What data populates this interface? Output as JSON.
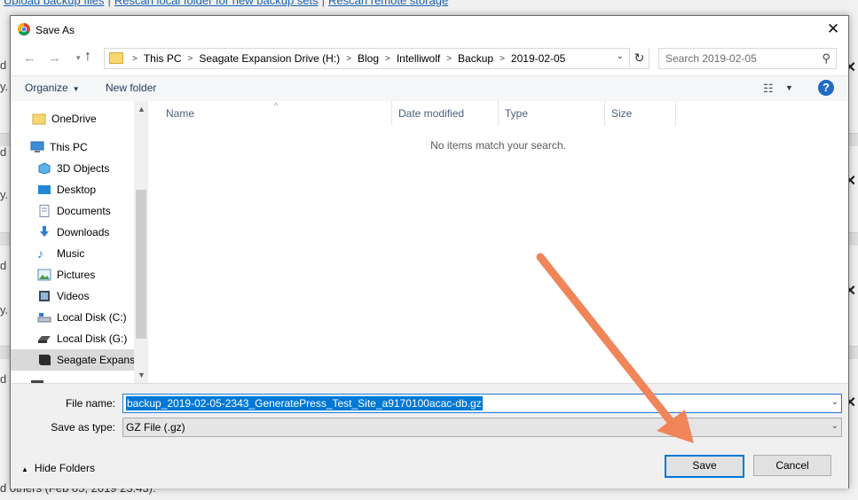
{
  "background": {
    "top_links": [
      "Upload backup files",
      "Rescan local folder for new backup sets",
      "Rescan remote storage"
    ],
    "fragments": [
      "d",
      "y.",
      "d",
      "y.",
      "d",
      "y.",
      "d"
    ],
    "bottom_text": "d others (Feb 05, 2019 23:43):",
    "close_glyph": "✕"
  },
  "dialog": {
    "title": "Save As",
    "close_glyph": "✕",
    "address": {
      "crumbs": [
        "This PC",
        "Seagate Expansion Drive (H:)",
        "Blog",
        "Intelliwolf",
        "Backup",
        "2019-02-05"
      ]
    },
    "search": {
      "placeholder": "Search 2019-02-05"
    },
    "toolbar": {
      "organize": "Organize",
      "new_folder": "New folder",
      "help": "?"
    },
    "nav": {
      "items": [
        {
          "label": "OneDrive",
          "icon": "folder-icon"
        },
        {
          "label": "This PC",
          "icon": "computer-icon"
        },
        {
          "label": "3D Objects",
          "icon": "cube-icon"
        },
        {
          "label": "Desktop",
          "icon": "desktop-icon"
        },
        {
          "label": "Documents",
          "icon": "document-icon"
        },
        {
          "label": "Downloads",
          "icon": "download-icon"
        },
        {
          "label": "Music",
          "icon": "music-icon"
        },
        {
          "label": "Pictures",
          "icon": "picture-icon"
        },
        {
          "label": "Videos",
          "icon": "video-icon"
        },
        {
          "label": "Local Disk (C:)",
          "icon": "disk-icon"
        },
        {
          "label": "Local Disk (G:)",
          "icon": "disk-icon"
        },
        {
          "label": "Seagate Expansic",
          "icon": "drive-icon",
          "selected": true
        }
      ]
    },
    "columns": [
      "Name",
      "Date modified",
      "Type",
      "Size"
    ],
    "empty_message": "No items match your search.",
    "file_name": {
      "label": "File name:",
      "value": "backup_2019-02-05-2343_GeneratePress_Test_Site_a9170100acac-db.gz"
    },
    "save_as_type": {
      "label": "Save as type:",
      "value": "GZ File (.gz)"
    },
    "hide_folders": "Hide Folders",
    "buttons": {
      "save": "Save",
      "cancel": "Cancel"
    }
  },
  "colors": {
    "accent": "#0078d7",
    "annotation_arrow": "#f0855a",
    "help_icon": "#1f6bc6",
    "folder_yellow": "#f7d774"
  }
}
